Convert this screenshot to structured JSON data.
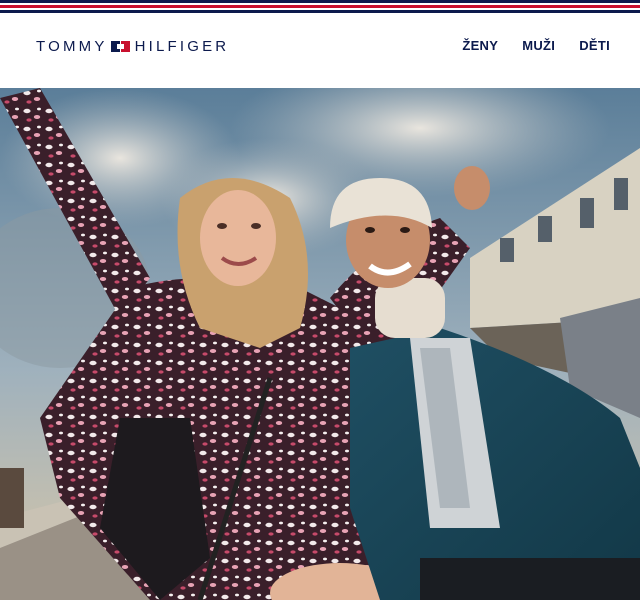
{
  "brand": {
    "logo_left": "TOMMY",
    "logo_right": "HILFIGER",
    "flag_icon": "tommy-flag-icon",
    "colors": {
      "navy": "#0c1a4d",
      "red": "#c8102e",
      "white": "#ffffff"
    }
  },
  "nav": {
    "items": [
      {
        "label": "ŽENY"
      },
      {
        "label": "MUŽI"
      },
      {
        "label": "DĚTI"
      }
    ]
  },
  "hero": {
    "image_subject": "hero-photo"
  }
}
